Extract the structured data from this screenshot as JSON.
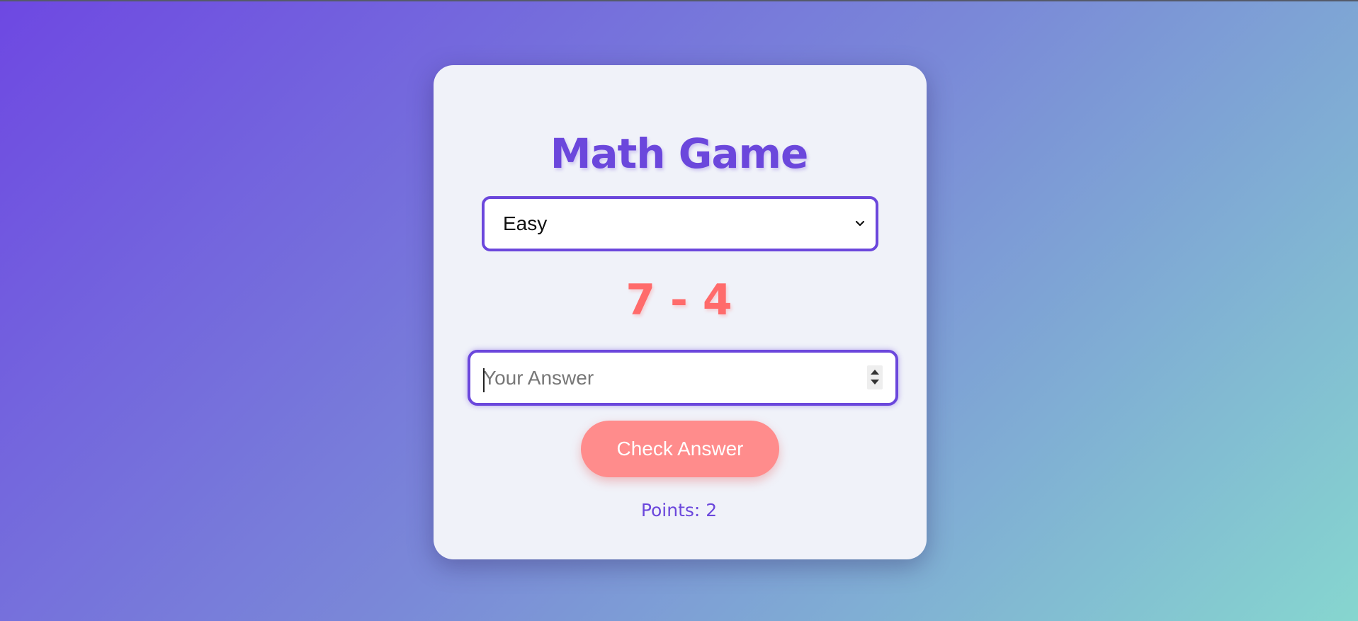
{
  "page": {
    "title": "Math Game"
  },
  "difficulty": {
    "selected": "Easy"
  },
  "question": {
    "text": "7 - 4"
  },
  "answer": {
    "placeholder": "Your Answer",
    "value": ""
  },
  "check_button": {
    "label": "Check Answer"
  },
  "score": {
    "text": "Points: 2"
  },
  "colors": {
    "accent": "#6b47dc",
    "question": "#ff6b6b",
    "button": "#ff8c8c",
    "card": "#f0f2f9"
  }
}
